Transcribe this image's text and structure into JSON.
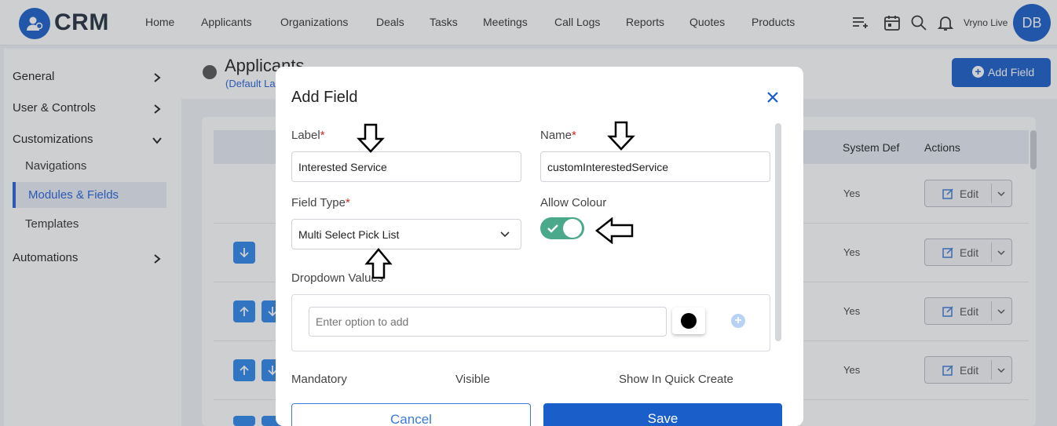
{
  "app": {
    "logo_text": "CRM",
    "org_name": "Vryno Live",
    "user_initials": "DB"
  },
  "nav": [
    "Home",
    "Applicants",
    "Organizations",
    "Deals",
    "Tasks",
    "Meetings",
    "Call Logs",
    "Reports",
    "Quotes",
    "Products"
  ],
  "sidebar": {
    "general": "General",
    "user_controls": "User & Controls",
    "customizations": "Customizations",
    "navigations": "Navigations",
    "modules_fields": "Modules & Fields",
    "templates": "Templates",
    "automations": "Automations"
  },
  "page": {
    "title": "Applicants",
    "subtitle": "(Default La",
    "add_field": "Add Field"
  },
  "table": {
    "headers": {
      "system_def": "System Def",
      "actions": "Actions"
    },
    "rows": [
      {
        "system_def": "Yes",
        "edit": "Edit"
      },
      {
        "system_def": "Yes",
        "edit": "Edit"
      },
      {
        "system_def": "Yes",
        "edit": "Edit"
      },
      {
        "system_def": "Yes",
        "edit": "Edit"
      }
    ]
  },
  "modal": {
    "title": "Add Field",
    "label_label": "Label",
    "label_value": "Interested Service",
    "name_label": "Name",
    "name_value": "customInterestedService",
    "field_type_label": "Field Type",
    "field_type_value": "Multi Select Pick List",
    "allow_colour_label": "Allow Colour",
    "allow_colour_on": true,
    "dropdown_values_label": "Dropdown Values",
    "option_placeholder": "Enter option to add",
    "swatch_color": "#000000",
    "mandatory_label": "Mandatory",
    "visible_label": "Visible",
    "quick_create_label": "Show In Quick Create",
    "required_mark": "*",
    "cancel": "Cancel",
    "save": "Save"
  },
  "colors": {
    "brand": "#1a5ec9",
    "toggle_on": "#4aa98b",
    "required": "#c62828"
  }
}
